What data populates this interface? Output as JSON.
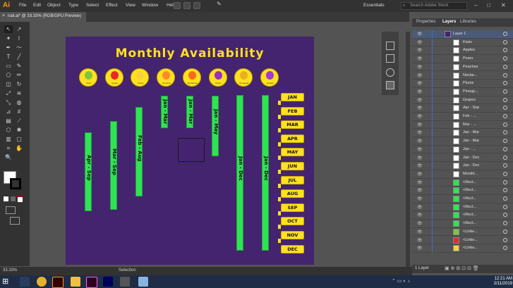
{
  "app": {
    "logo": "Ai",
    "menu": [
      "File",
      "Edit",
      "Object",
      "Type",
      "Select",
      "Effect",
      "View",
      "Window",
      "Help"
    ],
    "workspace": "Essentials",
    "search_placeholder": "Search Adobe Stock"
  },
  "document": {
    "tab_title": "nail.ai* @ 33.33% (RGB/GPU Preview)"
  },
  "artboard": {
    "title": "Monthly Availability",
    "fruits": [
      {
        "name": "Kiwis",
        "color": "#7cc83a"
      },
      {
        "name": "Apples",
        "color": "#e62a2a"
      },
      {
        "name": "Pears",
        "color": "#f3d53a"
      },
      {
        "name": "Peaches",
        "color": "#ff8a2a"
      },
      {
        "name": "Nectarines",
        "color": "#ff6a1a"
      },
      {
        "name": "Plums",
        "color": "#9b2fc0"
      },
      {
        "name": "Pineapple",
        "color": "#e8b020"
      },
      {
        "name": "Grapes",
        "color": "#a03ad0"
      }
    ],
    "bars": [
      {
        "label": "Apr - Sep",
        "start": 4,
        "end": 9
      },
      {
        "label": "Mar - Sep",
        "start": 3,
        "end": 9
      },
      {
        "label": "Feb - Aug",
        "start": 2,
        "end": 8
      },
      {
        "label": "Jan - Mar",
        "start": 1,
        "end": 3
      },
      {
        "label": "Jan - Mar",
        "start": 1,
        "end": 3
      },
      {
        "label": "Jan - May",
        "start": 1,
        "end": 5
      },
      {
        "label": "Jan - Dec",
        "start": 1,
        "end": 12
      },
      {
        "label": "Jan - Dec",
        "start": 1,
        "end": 12
      }
    ],
    "months": [
      "JAN",
      "FEB",
      "MAR",
      "APR",
      "MAY",
      "JUN",
      "JUL",
      "AUG",
      "SEP",
      "OCT",
      "NOV",
      "DEC"
    ]
  },
  "panel": {
    "tabs": [
      "Properties",
      "Layers",
      "Libraries"
    ],
    "active_tab": "Layers",
    "layers": [
      "Layer 1",
      "Kiwis",
      "Apples",
      "Pears",
      "Peaches",
      "Nectar...",
      "Plums",
      "Pineap...",
      "Grapes",
      "Apr - Sep",
      "Feb - ...",
      "Mar - ...",
      "Jan - Mar",
      "Jan - Mar",
      "Jan - ...",
      "Jan - Dec",
      "Jan - Dec",
      "Monthl...",
      "<Rect...",
      "<Rect...",
      "<Rect...",
      "<Rect...",
      "<Rect...",
      "<Rect...",
      "<Linke...",
      "<Linke...",
      "<Linke..."
    ],
    "footer": "1 Layer"
  },
  "status": {
    "zoom": "33.33%",
    "mode": "Selection"
  },
  "clock": {
    "time": "12:21 AM",
    "date": "2/11/2019"
  }
}
